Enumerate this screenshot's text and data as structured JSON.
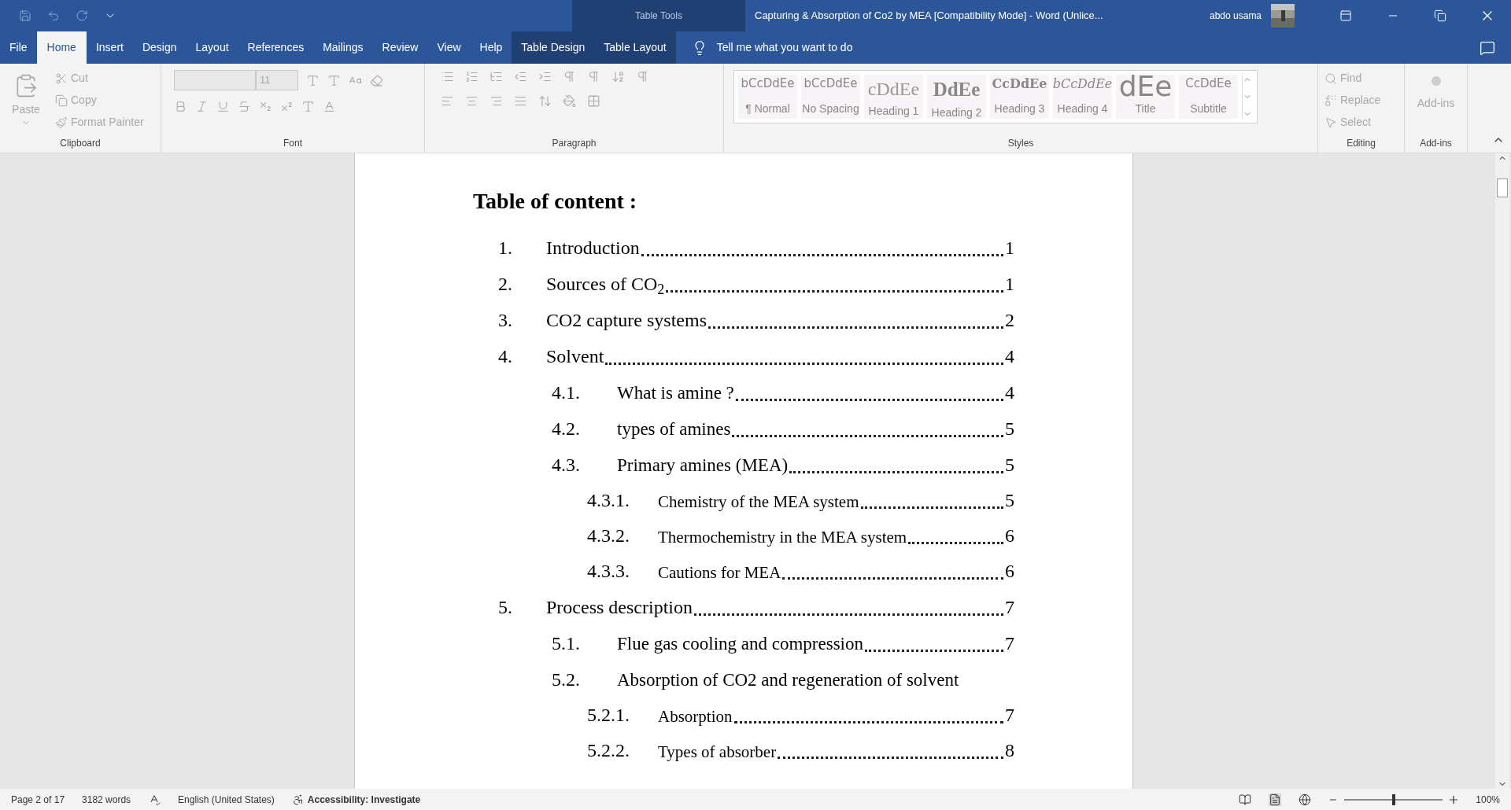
{
  "title_bar": {
    "contextual_label": "Table Tools",
    "title": "Capturing & Absorption   of Co2  by MEA [Compatibility Mode]  -  Word (Unlice...",
    "user": "abdo usama"
  },
  "tabs": [
    {
      "label": "File",
      "selected": false,
      "contextual": false
    },
    {
      "label": "Home",
      "selected": true,
      "contextual": false
    },
    {
      "label": "Insert",
      "selected": false,
      "contextual": false
    },
    {
      "label": "Design",
      "selected": false,
      "contextual": false
    },
    {
      "label": "Layout",
      "selected": false,
      "contextual": false
    },
    {
      "label": "References",
      "selected": false,
      "contextual": false
    },
    {
      "label": "Mailings",
      "selected": false,
      "contextual": false
    },
    {
      "label": "Review",
      "selected": false,
      "contextual": false
    },
    {
      "label": "View",
      "selected": false,
      "contextual": false
    },
    {
      "label": "Help",
      "selected": false,
      "contextual": false
    },
    {
      "label": "Table Design",
      "selected": false,
      "contextual": true
    },
    {
      "label": "Table Layout",
      "selected": false,
      "contextual": true
    }
  ],
  "tell_me": {
    "placeholder": "Tell me what you want to do"
  },
  "ribbon": {
    "disabled": true,
    "clipboard": {
      "paste": "Paste",
      "cut": "Cut",
      "copy": "Copy",
      "format_painter": "Format Painter",
      "group": "Clipboard"
    },
    "font": {
      "size": "11",
      "group": "Font"
    },
    "paragraph": {
      "group": "Paragraph"
    },
    "styles": {
      "group": "Styles",
      "items": [
        {
          "preview": "bCcDdEe",
          "name": "¶ Normal",
          "kind": "plain"
        },
        {
          "preview": "bCcDdEe",
          "name": "No Spacing",
          "kind": "plain"
        },
        {
          "preview": "cDdEe",
          "name": "Heading 1",
          "kind": "light"
        },
        {
          "preview": "DdEe",
          "name": "Heading 2",
          "kind": "bold"
        },
        {
          "preview": "CcDdEe",
          "name": "Heading 3",
          "kind": "semibold"
        },
        {
          "preview": "bCcDdEe",
          "name": "Heading 4",
          "kind": "italic"
        },
        {
          "preview": "dEe",
          "name": "Title",
          "kind": "large"
        },
        {
          "preview": "CcDdEe",
          "name": "Subtitle",
          "kind": "plain"
        }
      ]
    },
    "editing": {
      "find": "Find",
      "replace": "Replace",
      "select": "Select",
      "group": "Editing"
    },
    "addins": {
      "button": "Add-ins",
      "group": "Add-ins"
    }
  },
  "document": {
    "heading": "Table of content :",
    "toc": [
      {
        "number": "1.",
        "title": "Introduction",
        "page": "1"
      },
      {
        "number": "2.",
        "title": "Sources of CO$_{2}$",
        "page": "1"
      },
      {
        "number": "3.",
        "title": "CO2 capture systems",
        "page": "2"
      },
      {
        "number": "4.",
        "title": "Solvent",
        "page": "4",
        "children": [
          {
            "number": "4.1.",
            "title": "What is amine ?",
            "page": "4"
          },
          {
            "number": "4.2.",
            "title": "types of amines",
            "page": "5"
          },
          {
            "number": "4.3.",
            "title": "Primary amines (MEA)",
            "page": "5",
            "children": [
              {
                "number": "4.3.1.",
                "title": "Chemistry of the MEA system",
                "page": "5"
              },
              {
                "number": "4.3.2.",
                "title": "Thermochemistry in the MEA system",
                "page": "6"
              },
              {
                "number": "4.3.3.",
                "title": "Cautions for MEA",
                "page": "6"
              }
            ]
          }
        ]
      },
      {
        "number": "5.",
        "title": "Process description",
        "page": "7",
        "children": [
          {
            "number": "5.1.",
            "title": "Flue gas cooling and compression",
            "page": "7"
          },
          {
            "number": "5.2.",
            "title": "Absorption of CO2 and regeneration of solvent",
            "children": [
              {
                "number": "5.2.1.",
                "title": "Absorption",
                "page": "7"
              },
              {
                "number": "5.2.2.",
                "title": "Types of absorber",
                "page": "8"
              }
            ]
          }
        ]
      }
    ]
  },
  "status_bar": {
    "page": "Page 2 of 17",
    "words": "3182 words",
    "language": "English (United States)",
    "accessibility": "Accessibility: Investigate",
    "zoom": {
      "level": 0.5,
      "reading": "100%"
    }
  }
}
